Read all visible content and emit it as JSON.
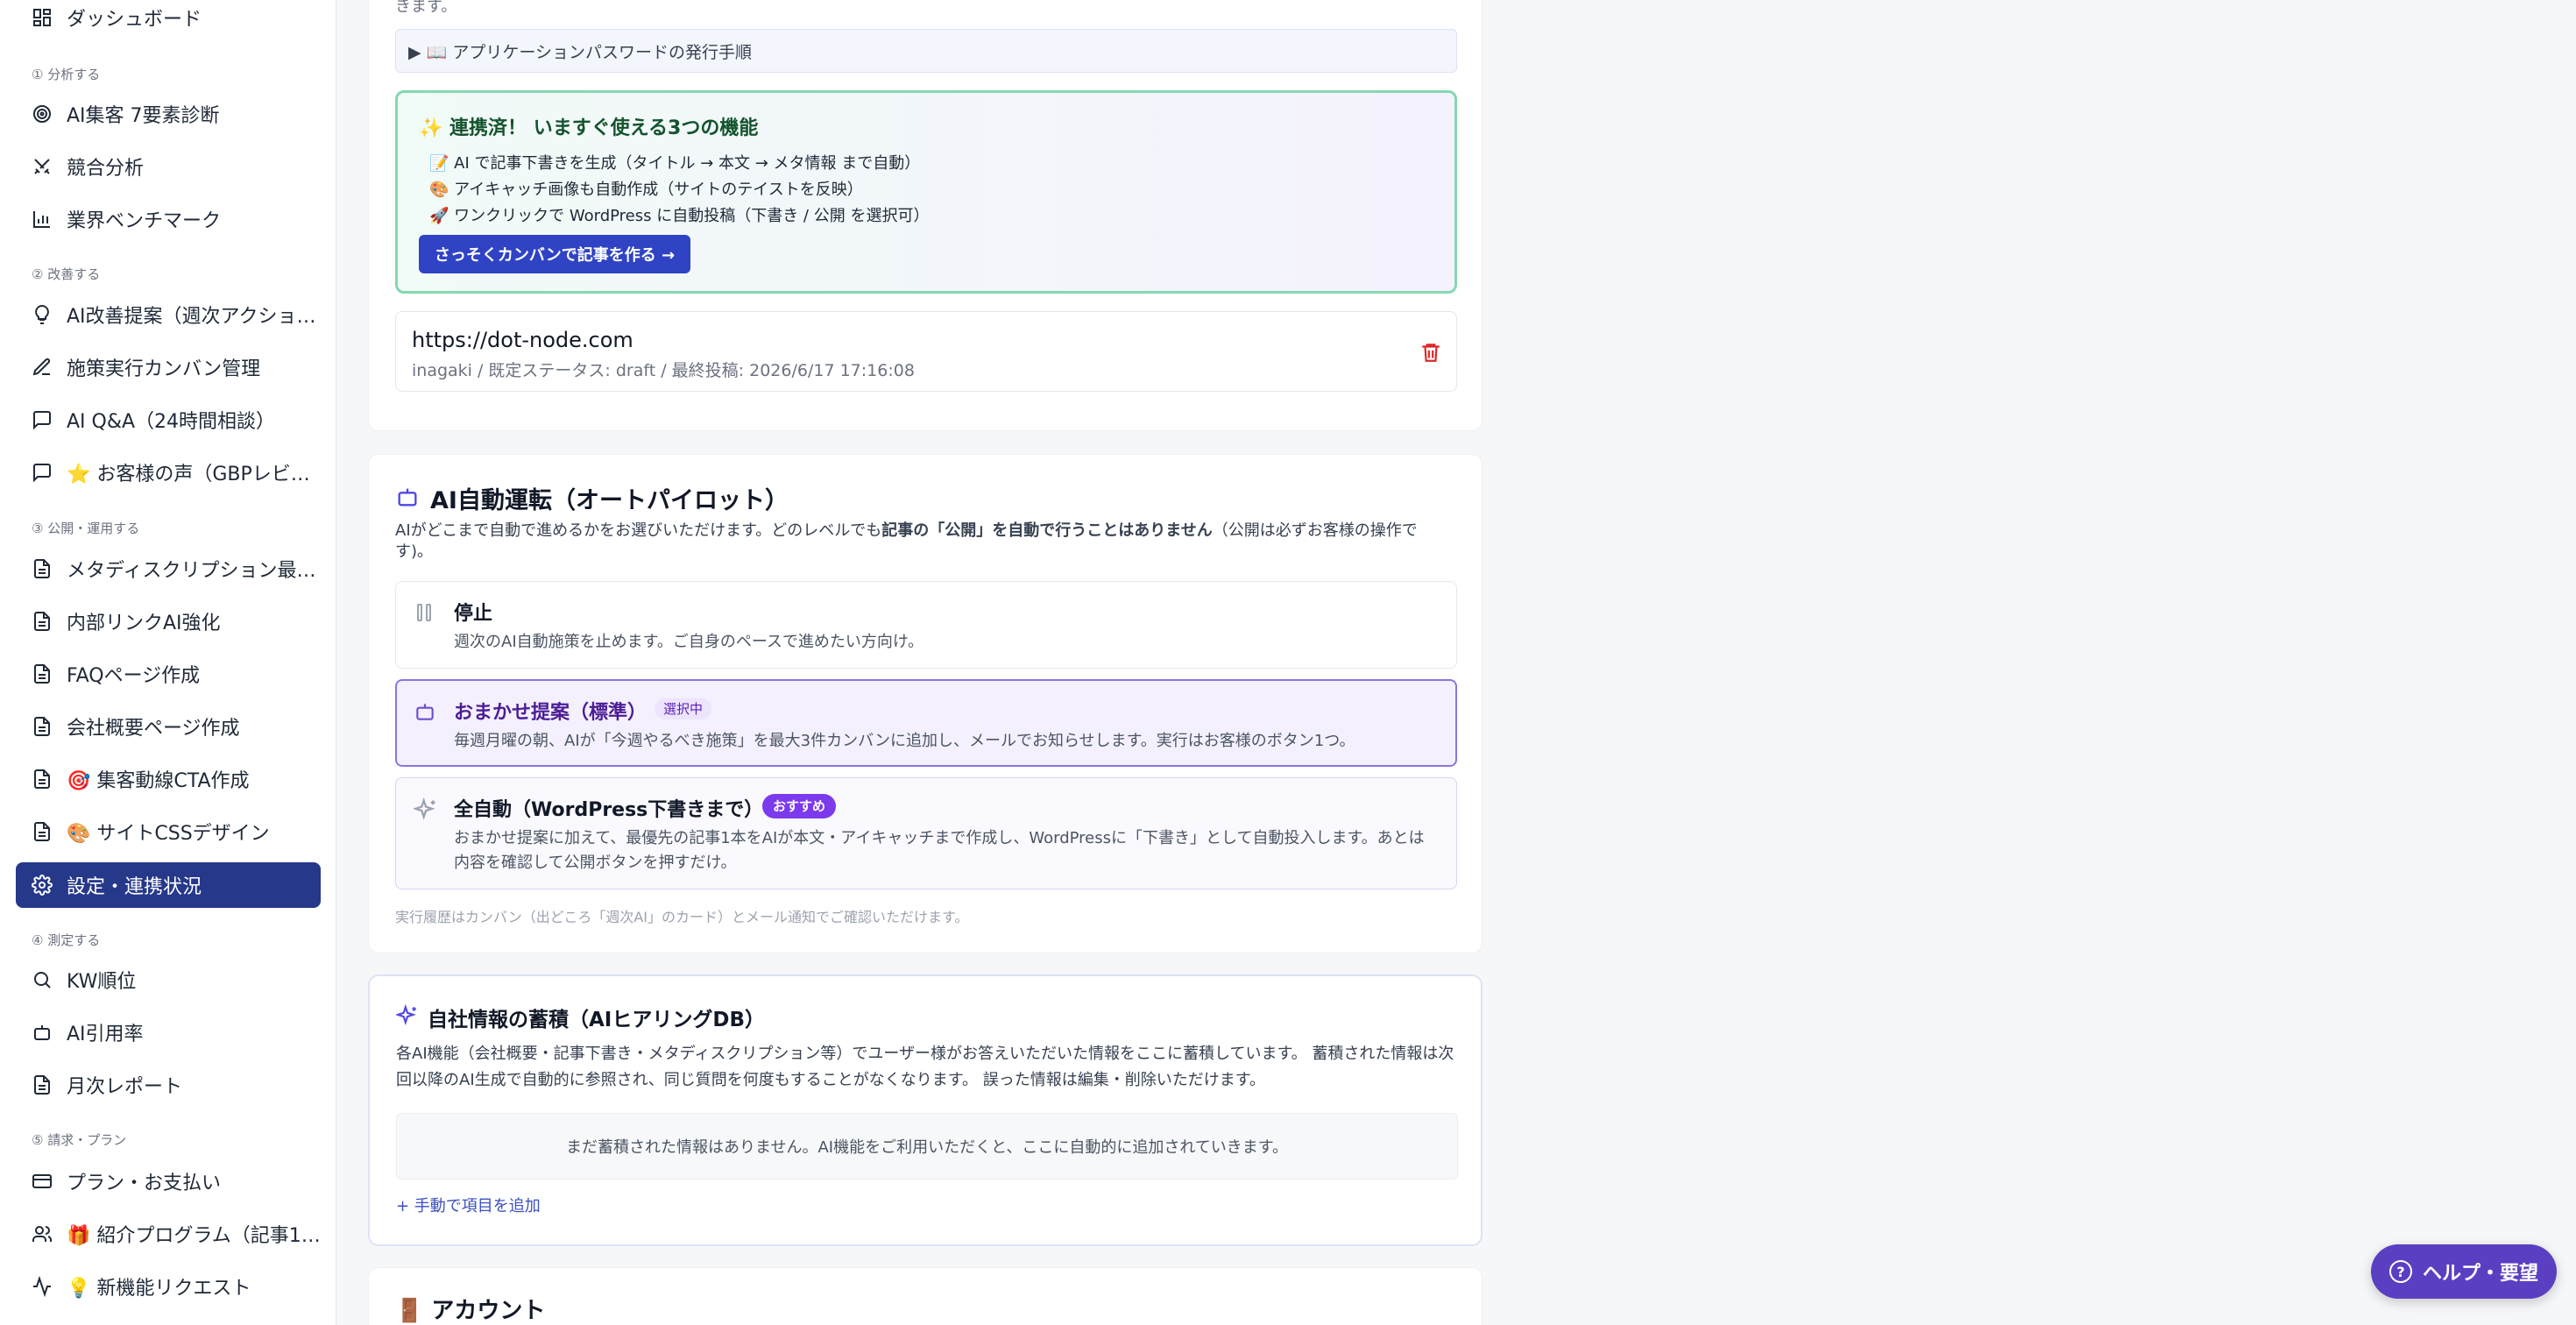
{
  "sidebar": {
    "items": [
      {
        "label": "ダッシュボード",
        "icon": "grid-icon"
      },
      {
        "label": "AI集客 7要素診断",
        "icon": "target-icon"
      },
      {
        "label": "競合分析",
        "icon": "swords-icon"
      },
      {
        "label": "業界ベンチマーク",
        "icon": "bar-chart-icon"
      },
      {
        "label": "AI改善提案（週次アクショ…",
        "icon": "lightbulb-icon"
      },
      {
        "label": "施策実行カンバン管理",
        "icon": "edit-icon"
      },
      {
        "label": "AI Q&A（24時間相談）",
        "icon": "chat-icon"
      },
      {
        "label": "⭐ お客様の声（GBPレビ…",
        "icon": "chat-icon"
      },
      {
        "label": "メタディスクリプション最…",
        "icon": "document-icon"
      },
      {
        "label": "内部リンクAI強化",
        "icon": "document-icon"
      },
      {
        "label": "FAQページ作成",
        "icon": "document-icon"
      },
      {
        "label": "会社概要ページ作成",
        "icon": "document-icon"
      },
      {
        "label": "🎯 集客動線CTA作成",
        "icon": "document-icon"
      },
      {
        "label": "🎨 サイトCSSデザイン",
        "icon": "document-icon"
      },
      {
        "label": "設定・連携状況",
        "icon": "gear-icon"
      },
      {
        "label": "KW順位",
        "icon": "search-icon"
      },
      {
        "label": "AI引用率",
        "icon": "robot-icon"
      },
      {
        "label": "月次レポート",
        "icon": "document-icon"
      },
      {
        "label": "プラン・お支払い",
        "icon": "credit-card-icon"
      },
      {
        "label": "🎁 紹介プログラム（記事1…",
        "icon": "users-icon"
      },
      {
        "label": "💡 新機能リクエスト",
        "icon": "activity-icon"
      }
    ],
    "sections": [
      "① 分析する",
      "② 改善する",
      "③ 公開・運用する",
      "④ 測定する",
      "⑤ 請求・プラン"
    ]
  },
  "wp": {
    "top_fragment": "きます。",
    "howto_label": "▶ 📖 アプリケーションパスワードの発行手順",
    "promo": {
      "title": "✨ 連携済！ いますぐ使える3つの機能",
      "lines": [
        "📝 AI で記事下書きを生成（タイトル → 本文 → メタ情報 まで自動）",
        "🎨 アイキャッチ画像も自動作成（サイトのテイストを反映）",
        "🚀 ワンクリックで WordPress に自動投稿（下書き / 公開 を選択可）"
      ],
      "cta": "さっそくカンバンで記事を作る →"
    },
    "site": {
      "url": "https://dot-node.com",
      "meta": "inagaki / 既定ステータス: draft / 最終投稿: 2026/6/17 17:16:08"
    }
  },
  "autopilot": {
    "title": "AI自動運転（オートパイロット）",
    "desc_prefix": "AIがどこまで自動で進めるかをお選びいただけます。どのレベルでも",
    "desc_bold": "記事の「公開」を自動で行うことはありません",
    "desc_suffix": "（公開は必ずお客様の操作で",
    "desc_line2": "す)。",
    "options": [
      {
        "title": "停止",
        "desc": "週次のAI自動施策を止めます。ご自身のペースで進めたい方向け。",
        "icon": "pause-icon"
      },
      {
        "title": "おまかせ提案（標準）",
        "badge": "選択中",
        "desc": "毎週月曜の朝、AIが「今週やるべき施策」を最大3件カンバンに追加し、メールでお知らせします。実行はお客様のボタン1つ。",
        "icon": "robot-icon"
      },
      {
        "title": "全自動（WordPress下書きまで）",
        "badge": "おすすめ",
        "desc_line1": "おまかせ提案に加えて、最優先の記事1本をAIが本文・アイキャッチまで作成し、WordPressに「下書き」として自動投入します。あとは",
        "desc_line2": "内容を確認して公開ボタンを押すだけ。",
        "icon": "sparkles-icon"
      }
    ],
    "footnote": "実行履歴はカンバン（出どころ「週次AI」のカード）とメール通知でご確認いただけます。"
  },
  "kb": {
    "title": "自社情報の蓄積（AIヒアリングDB）",
    "desc_line1": "各AI機能（会社概要・記事下書き・メタディスクリプション等）でユーザー様がお答えいただいた情報をここに蓄積しています。 蓄積された情報は次",
    "desc_line2": "回以降のAI生成で自動的に参照され、同じ質問を何度もすることがなくなります。 誤った情報は編集・削除いただけます。",
    "empty": "まだ蓄積された情報はありません。AI機能をご利用いただくと、ここに自動的に追加されていきます。",
    "add_link": "+ 手動で項目を追加"
  },
  "account": {
    "title": "🚪 アカウント"
  },
  "help": {
    "label": "ヘルプ・要望"
  },
  "colors": {
    "accent": "#26388a",
    "purple": "#5b3fc2",
    "green_border": "#86d8b0",
    "danger": "#dc2626"
  }
}
